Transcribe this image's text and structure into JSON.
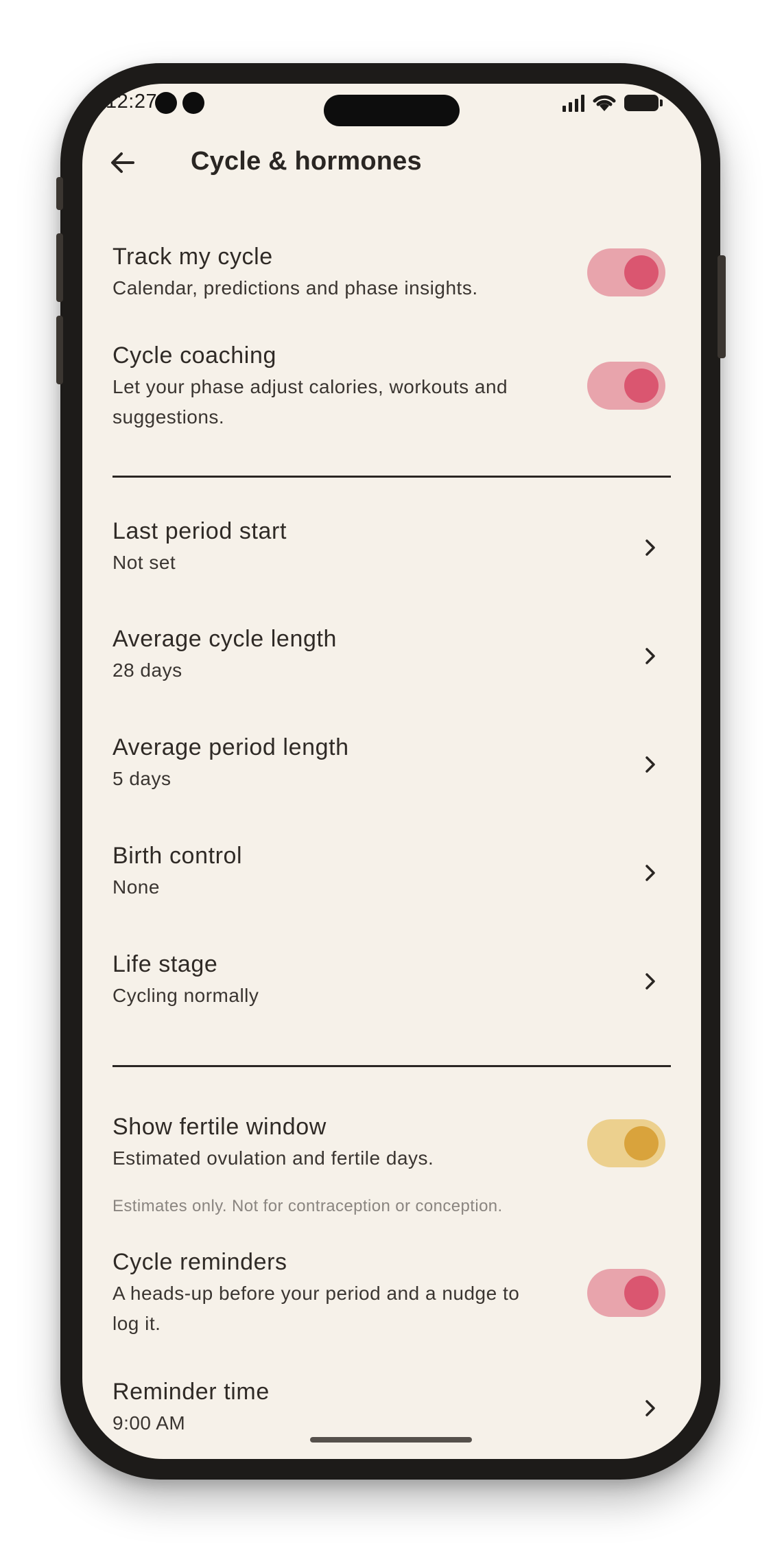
{
  "status_bar": {
    "time": "12:27"
  },
  "header": {
    "title": "Cycle & hormones",
    "back_icon": "arrow-left-icon"
  },
  "colors": {
    "background": "#f6f1e9",
    "toggle_pink_track": "#e8a4ac",
    "toggle_pink_knob": "#da5670",
    "toggle_gold_track": "#ecd08e",
    "toggle_gold_knob": "#d9a33c",
    "text": "#2a2623"
  },
  "settings": {
    "track_cycle": {
      "title": "Track my cycle",
      "subtitle": "Calendar, predictions and phase insights.",
      "enabled": true
    },
    "cycle_coaching": {
      "title": "Cycle coaching",
      "subtitle": "Let your phase adjust calories, workouts and suggestions.",
      "enabled": true
    },
    "last_period_start": {
      "title": "Last period start",
      "value": "Not set"
    },
    "avg_cycle_length": {
      "title": "Average cycle length",
      "value": "28 days"
    },
    "avg_period_length": {
      "title": "Average period length",
      "value": "5 days"
    },
    "birth_control": {
      "title": "Birth control",
      "value": "None"
    },
    "life_stage": {
      "title": "Life stage",
      "value": "Cycling normally"
    },
    "fertile_window": {
      "title": "Show fertile window",
      "subtitle": "Estimated ovulation and fertile days.",
      "enabled": true,
      "footnote": "Estimates only. Not for contraception or conception."
    },
    "cycle_reminders": {
      "title": "Cycle reminders",
      "subtitle": "A heads-up before your period and a nudge to log it.",
      "enabled": true
    },
    "reminder_time": {
      "title": "Reminder time",
      "value": "9:00 AM"
    }
  }
}
